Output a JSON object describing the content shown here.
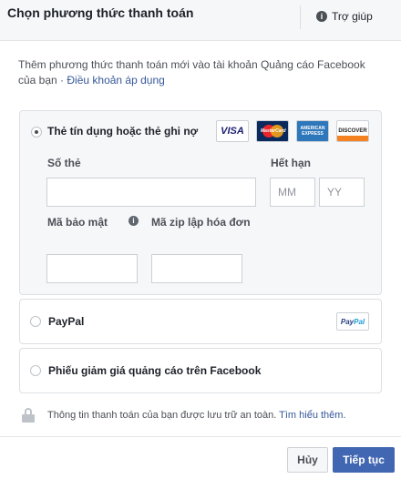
{
  "header": {
    "title": "Chọn phương thức thanh toán",
    "help_label": "Trợ giúp"
  },
  "intro": {
    "text": "Thêm phương thức thanh toán mới vào tài khoản Quảng cáo Facebook của bạn",
    "separator": " · ",
    "terms_link": "Điều khoản áp dụng"
  },
  "options": {
    "card": {
      "label": "Thẻ tín dụng hoặc thẻ ghi nợ",
      "selected": true,
      "logos": {
        "visa": "VISA",
        "mastercard": "MasterCard",
        "amex_line1": "AMERICAN",
        "amex_line2": "EXPRESS",
        "discover": "DISCOVER"
      },
      "fields": {
        "card_number_label": "Số thẻ",
        "card_number_value": "",
        "expiry_label": "Hết hạn",
        "month_placeholder": "MM",
        "year_placeholder": "YY",
        "security_code_label": "Mã bảo mật",
        "security_code_value": "",
        "zip_label": "Mã zip lập hóa đơn",
        "zip_value": ""
      }
    },
    "paypal": {
      "label": "PayPal",
      "selected": false,
      "badge_part1": "Pay",
      "badge_part2": "Pal"
    },
    "coupon": {
      "label": "Phiếu giảm giá quảng cáo trên Facebook",
      "selected": false
    }
  },
  "secure_note": {
    "text": "Thông tin thanh toán của bạn được lưu trữ an toàn. ",
    "link": "Tìm hiểu thêm."
  },
  "buttons": {
    "cancel": "Hủy",
    "next": "Tiếp tục"
  },
  "colors": {
    "primary": "#4267b2",
    "link": "#365899",
    "panel_bg": "#f6f7f9"
  }
}
